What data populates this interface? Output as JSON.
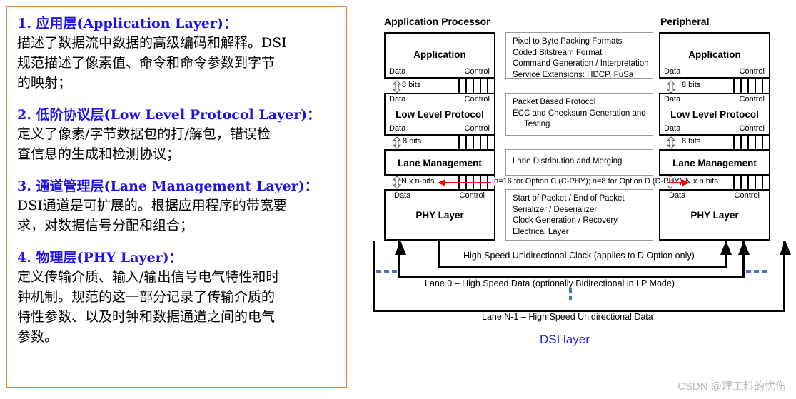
{
  "left_panel": {
    "border_color": "#E8813A",
    "heading_color": "#1F12E8",
    "blocks": [
      {
        "heading": "1. 应用层(Application Layer)：",
        "lines": [
          "描述了数据流中数据的高级编码和解释。DSI",
          "规范描述了像素值、命令和命令参数到字节",
          "的映射；"
        ]
      },
      {
        "heading": "2. 低阶协议层(Low Level Protocol Layer)：",
        "lines": [
          "定义了像素/字节数据包的打/解包，错误检",
          "查信息的生成和检测协议；"
        ]
      },
      {
        "heading": "3. 通道管理层(Lane Management Layer)：",
        "lines": [
          "DSI通道是可扩展的。根据应用程序的带宽要",
          "求，对数据信号分配和组合；"
        ]
      },
      {
        "heading": "4. 物理层(PHY Layer)：",
        "lines": [
          "定义传输介质、输入/输出信号电气特性和时",
          "钟机制。规范的这一部分记录了传输介质的",
          "特性参数、以及时钟和数据通道之间的电气",
          "参数。"
        ]
      }
    ]
  },
  "diagram": {
    "left_column_title": "Application Processor",
    "right_column_title": "Peripheral",
    "pin_labels": {
      "data": "Data",
      "control": "Control"
    },
    "stack": [
      {
        "title": "Application",
        "top_pins": false,
        "bottom_pins": true
      },
      {
        "title": "Low Level Protocol",
        "top_pins": true,
        "bottom_pins": true
      },
      {
        "title": "Lane Management",
        "top_pins": false,
        "bottom_pins": false
      },
      {
        "title": "PHY Layer",
        "top_pins": true,
        "bottom_pins": false
      }
    ],
    "connectors": [
      {
        "label_left": "8 bits",
        "label_right": "8 bits"
      },
      {
        "label_left": "8 bits",
        "label_right": "8 bits"
      },
      {
        "label_left": "N x n-bits",
        "label_right": "N x n bits"
      }
    ],
    "option_note": "n=16 for Option C (C-PHY); n=8 for Option D (D-PHY)",
    "option_note_arrow_color": "#FF0000",
    "middle_boxes": [
      {
        "lines": [
          {
            "text": "Pixel to Byte Packing Formats",
            "indent": false
          },
          {
            "text": "Coded Bitstream Format",
            "indent": false
          },
          {
            "text": "Command Generation / Interpretation",
            "indent": false
          },
          {
            "text": "Service Extensions: HDCP, FuSa",
            "indent": false
          }
        ]
      },
      {
        "lines": [
          {
            "text": "Packet Based Protocol",
            "indent": false
          },
          {
            "text": "ECC and Checksum Generation and",
            "indent": false
          },
          {
            "text": "Testing",
            "indent": true
          }
        ]
      },
      {
        "lines": [
          {
            "text": "Lane Distribution and Merging",
            "indent": false
          }
        ]
      },
      {
        "lines": [
          {
            "text": "Start of Packet / End of Packet",
            "indent": false
          },
          {
            "text": "Serializer / Deserializer",
            "indent": false
          },
          {
            "text": "Clock Generation / Recovery",
            "indent": false
          },
          {
            "text": "Electrical Layer",
            "indent": false
          }
        ]
      }
    ],
    "bottom_lanes": [
      "High Speed Unidirectional Clock (applies to D Option only)",
      "Lane 0 – High Speed Data (optionally Bidirectional in LP Mode)",
      "Lane N-1 – High Speed Unidirectional Data"
    ],
    "dashed_color": "#4472C4",
    "caption": "DSI layer",
    "caption_color": "#2222EE"
  },
  "watermark": "CSDN @理工科的忧伤"
}
